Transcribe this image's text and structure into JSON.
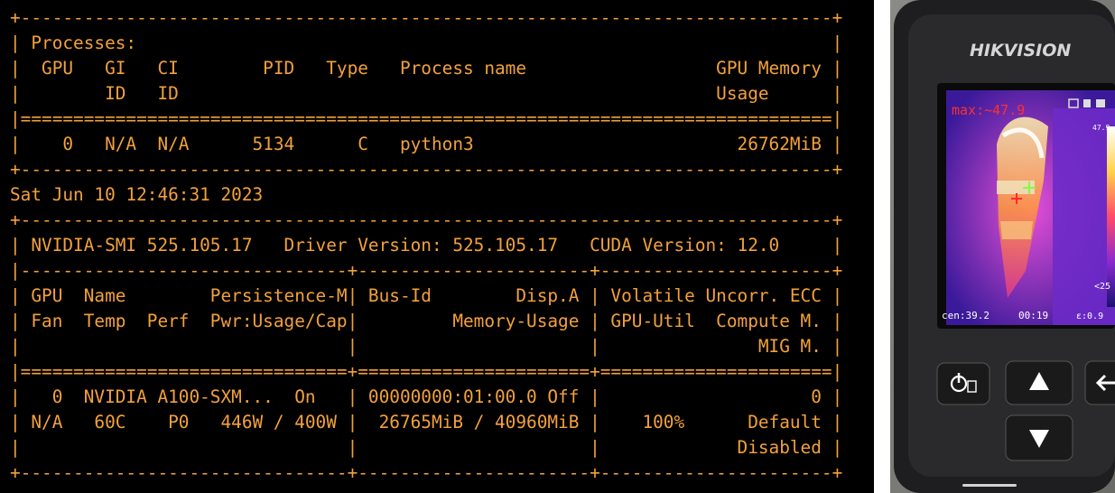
{
  "terminal": {
    "lines": [
      "+-----------------------------------------------------------------------------+",
      "| Processes:                                                                  |",
      "|  GPU   GI   CI        PID   Type   Process name                  GPU Memory |",
      "|        ID   ID                                                   Usage      |",
      "|=============================================================================|",
      "|    0   N/A  N/A      5134      C   python3                         26762MiB |",
      "+-----------------------------------------------------------------------------+",
      "Sat Jun 10 12:46:31 2023",
      "+-----------------------------------------------------------------------------+",
      "| NVIDIA-SMI 525.105.17   Driver Version: 525.105.17   CUDA Version: 12.0     |",
      "|-------------------------------+----------------------+----------------------+",
      "| GPU  Name        Persistence-M| Bus-Id        Disp.A | Volatile Uncorr. ECC |",
      "| Fan  Temp  Perf  Pwr:Usage/Cap|         Memory-Usage | GPU-Util  Compute M. |",
      "|                               |                      |               MIG M. |",
      "|===============================+======================+======================|",
      "|   0  NVIDIA A100-SXM...  On   | 00000000:01:00.0 Off |                    0 |",
      "| N/A   60C    P0   446W / 400W |  26765MiB / 40960MiB |    100%      Default |",
      "|                               |                      |             Disabled |",
      "+-------------------------------+----------------------+----------------------+"
    ],
    "text_color": "#f3a13c",
    "background": "#000000"
  },
  "camera_photo": {
    "brand": "HIKVISION",
    "max_readout": "max:~47.9",
    "scale_top": "47.9",
    "scale_bottom": "<25",
    "center_readout": "cen:39.2",
    "time_readout": "00:19",
    "icon_names": [
      "power-icon",
      "up-arrow-icon",
      "down-arrow-icon",
      "back-icon"
    ]
  }
}
